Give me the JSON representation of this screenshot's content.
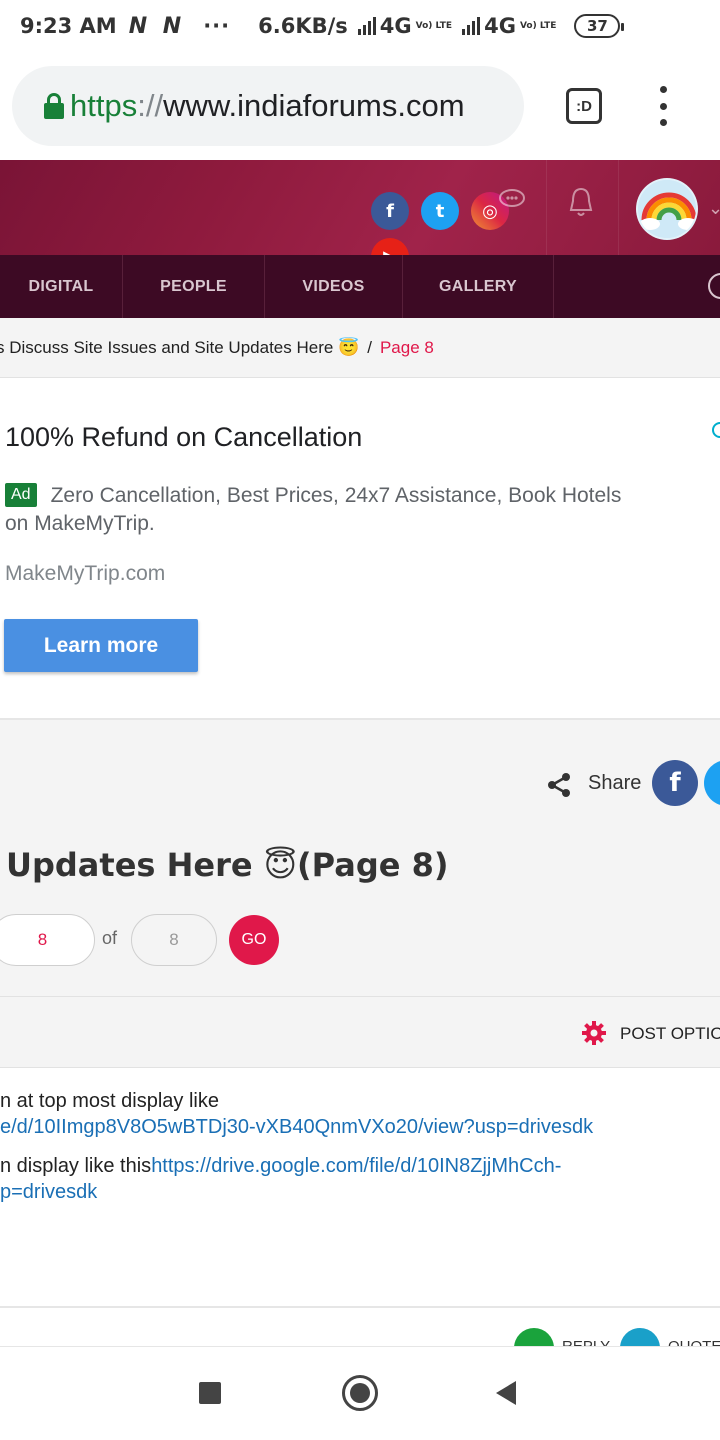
{
  "status_bar": {
    "time": "9:23 AM",
    "notification_icons": "N N",
    "more": "···",
    "speed": "6.6KB/s",
    "network1": "4G",
    "volte1": "Vo) LTE",
    "network2": "4G",
    "volte2": "Vo) LTE",
    "battery": "37"
  },
  "browser": {
    "url_scheme": "https",
    "url_sep": "://",
    "url_host": "www.indiaforums.com",
    "tab_switcher_label": ":D"
  },
  "site_header": {
    "social": {
      "facebook": "f",
      "twitter": "t",
      "instagram": "◎",
      "youtube": "▶"
    },
    "chat_icon": "chat-bubble-icon",
    "bell_icon": "bell-icon"
  },
  "nav": {
    "items": [
      "DIGITAL",
      "PEOPLE",
      "VIDEOS",
      "GALLERY"
    ]
  },
  "breadcrumb": {
    "crumb": "s Discuss Site Issues and Site Updates Here 😇",
    "separator": "/",
    "current": "Page 8"
  },
  "ad": {
    "title": "100% Refund on Cancellation",
    "badge": "Ad",
    "description": "Zero Cancellation, Best Prices, 24x7 Assistance, Book Hotels on MakeMyTrip.",
    "domain": "MakeMyTrip.com",
    "cta": "Learn more"
  },
  "topic": {
    "share_label": "Share",
    "share_facebook": "f",
    "share_twitter": "t",
    "title": "Updates Here 😇(Page 8)",
    "current_page": "8",
    "of_label": "of",
    "total_pages": "8",
    "go_label": "GO"
  },
  "post_options": {
    "label": "POST OPTION"
  },
  "post": {
    "line1": "n at top most display like",
    "line2_link": "e/d/10IImgp8V8O5wBTDj30-vXB40QnmVXo20/view?usp=drivesdk",
    "line3_text": "n display like this",
    "line3_link": "https://drive.google.com/file/d/10IN8ZjjMhCch-",
    "line4_link": "p=drivesdk"
  },
  "post_footer": {
    "reply_label": "REPLY",
    "quote_label": "QUOTE"
  },
  "colors": {
    "accent": "#e0184a",
    "header_bg": "#8e1a3d",
    "nav_bg": "#3d0a24",
    "link": "#1a6fb5",
    "ad_button": "#4a90e2"
  }
}
